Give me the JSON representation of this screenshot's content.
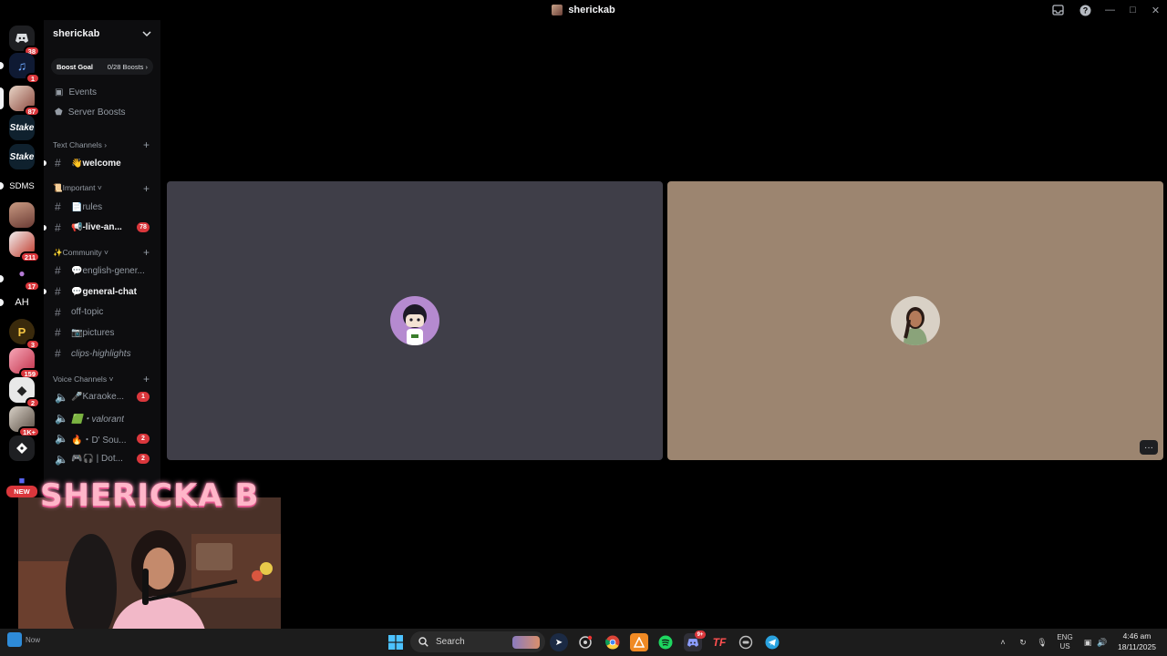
{
  "window": {
    "title": "sherickab"
  },
  "server": {
    "name": "sherickab",
    "boost_goal_label": "Boost Goal",
    "boost_progress": "0/28 Boosts"
  },
  "rail": {
    "badges": [
      "38",
      "1",
      "87",
      "211",
      "17",
      "3",
      "159",
      "2",
      "1K+"
    ],
    "labels": [
      "Stake",
      "Stake",
      "SDMS",
      "AH"
    ],
    "new_label": "NEW"
  },
  "menu": {
    "events": "Events",
    "server_boosts": "Server Boosts"
  },
  "categories": {
    "text": "Text Channels",
    "important": "📜Important",
    "community": "✨Community",
    "voice": "Voice Channels"
  },
  "channels": {
    "welcome": "👋welcome",
    "rules": "📄rules",
    "live": "📢-live-an...",
    "live_badge": "78",
    "english": "💬english-gener...",
    "general": "💬general-chat",
    "offtopic": "off-topic",
    "pictures": "📷pictures",
    "clips": "clips-highlights",
    "karaoke": "🎤Karaoke...",
    "karaoke_badge": "1",
    "valorant": "🟩・valorant",
    "dsou": "🔥・D' Sou...",
    "dsou_badge": "2",
    "dot": "🎮🎧 | Dot...",
    "dot_badge": "2"
  },
  "overlay": {
    "streamer_name": "SHERICKA B"
  },
  "taskbar": {
    "search_placeholder": "Search",
    "lang_top": "ENG",
    "lang_bottom": "US",
    "time": "4:46 am",
    "date": "18/11/2025",
    "widget_label": "Now",
    "discord_badge": "9+"
  },
  "colors": {
    "tile_left": "#3f3e48",
    "tile_right": "#9c8570",
    "danger_red": "#da373c",
    "accent_pink": "#ffb6c9"
  }
}
